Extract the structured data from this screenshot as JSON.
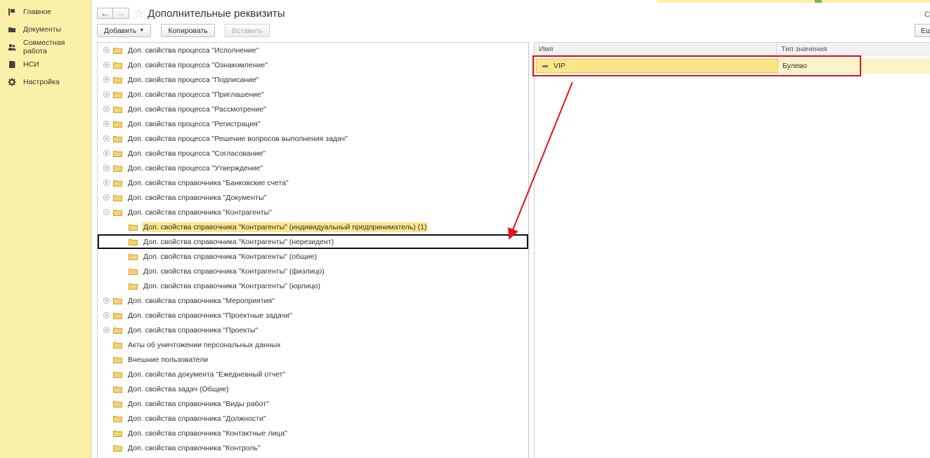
{
  "sidebar": {
    "items": [
      {
        "label": "Главное",
        "icon": "flag-icon"
      },
      {
        "label": "Документы",
        "icon": "folder-icon"
      },
      {
        "label": "Совместная работа",
        "icon": "users-icon"
      },
      {
        "label": "НСИ",
        "icon": "book-icon"
      },
      {
        "label": "Настройка",
        "icon": "gear-icon"
      }
    ]
  },
  "header": {
    "title": "Дополнительные реквизиты",
    "back_label": "←",
    "forward_label": "→",
    "star": "☆",
    "right_partial": "С"
  },
  "toolbar": {
    "add_label": "Добавить",
    "copy_label": "Копировать",
    "paste_label": "Вставить",
    "more_label": "Ещ"
  },
  "tree": {
    "rows": [
      {
        "label": "Доп. свойства процесса \"Исполнение\"",
        "level": 0,
        "expander": "+"
      },
      {
        "label": "Доп. свойства процесса \"Ознакомление\"",
        "level": 0,
        "expander": "+"
      },
      {
        "label": "Доп. свойства процесса \"Подписание\"",
        "level": 0,
        "expander": "+"
      },
      {
        "label": "Доп. свойства процесса \"Приглашение\"",
        "level": 0,
        "expander": "+"
      },
      {
        "label": "Доп. свойства процесса \"Рассмотрение\"",
        "level": 0,
        "expander": "+"
      },
      {
        "label": "Доп. свойства процесса \"Регистрация\"",
        "level": 0,
        "expander": "+"
      },
      {
        "label": "Доп. свойства процесса \"Решение вопросов выполнения задач\"",
        "level": 0,
        "expander": "+"
      },
      {
        "label": "Доп. свойства процесса \"Согласование\"",
        "level": 0,
        "expander": "+"
      },
      {
        "label": "Доп. свойства процесса \"Утверждение\"",
        "level": 0,
        "expander": "+"
      },
      {
        "label": "Доп. свойства справочника \"Банковские счета\"",
        "level": 0,
        "expander": "+"
      },
      {
        "label": "Доп. свойства справочника \"Документы\"",
        "level": 0,
        "expander": "+"
      },
      {
        "label": "Доп. свойства справочника \"Контрагенты\"",
        "level": 0,
        "expander": "−"
      },
      {
        "label": "Доп. свойства справочника \"Контрагенты\" (индивидуальный предприниматель) (1)",
        "level": 1,
        "expander": "",
        "selected": true
      },
      {
        "label": "Доп. свойства справочника \"Контрагенты\" (нерезидент)",
        "level": 1,
        "expander": "",
        "boxed": true
      },
      {
        "label": "Доп. свойства справочника \"Контрагенты\" (общие)",
        "level": 1,
        "expander": ""
      },
      {
        "label": "Доп. свойства справочника \"Контрагенты\" (физлицо)",
        "level": 1,
        "expander": ""
      },
      {
        "label": "Доп. свойства справочника \"Контрагенты\" (юрлицо)",
        "level": 1,
        "expander": ""
      },
      {
        "label": "Доп. свойства справочника \"Мероприятия\"",
        "level": 0,
        "expander": "+"
      },
      {
        "label": "Доп. свойства справочника \"Проектные задачи\"",
        "level": 0,
        "expander": "+"
      },
      {
        "label": "Доп. свойства справочника \"Проекты\"",
        "level": 0,
        "expander": "+"
      },
      {
        "label": "Акты об уничтожении персональных данных",
        "level": 0,
        "expander": ""
      },
      {
        "label": "Внешние пользователи",
        "level": 0,
        "expander": ""
      },
      {
        "label": "Доп. свойства документа \"Ежедневный отчет\"",
        "level": 0,
        "expander": ""
      },
      {
        "label": "Доп. свойства задач (Общие)",
        "level": 0,
        "expander": ""
      },
      {
        "label": "Доп. свойства справочника \"Виды работ\"",
        "level": 0,
        "expander": ""
      },
      {
        "label": "Доп. свойства справочника \"Должности\"",
        "level": 0,
        "expander": ""
      },
      {
        "label": "Доп. свойства справочника \"Контактные лица\"",
        "level": 0,
        "expander": ""
      },
      {
        "label": "Доп. свойства справочника \"Контроль\"",
        "level": 0,
        "expander": ""
      }
    ]
  },
  "grid": {
    "columns": [
      "Имя",
      "Тип значения"
    ],
    "rows": [
      {
        "name": "VIP",
        "type": "Булево"
      }
    ]
  },
  "colors": {
    "sidebar_bg": "#fbf0a8",
    "selection": "#fbe68a",
    "annotation_red": "#e0141b",
    "annotation_black": "#111111"
  }
}
